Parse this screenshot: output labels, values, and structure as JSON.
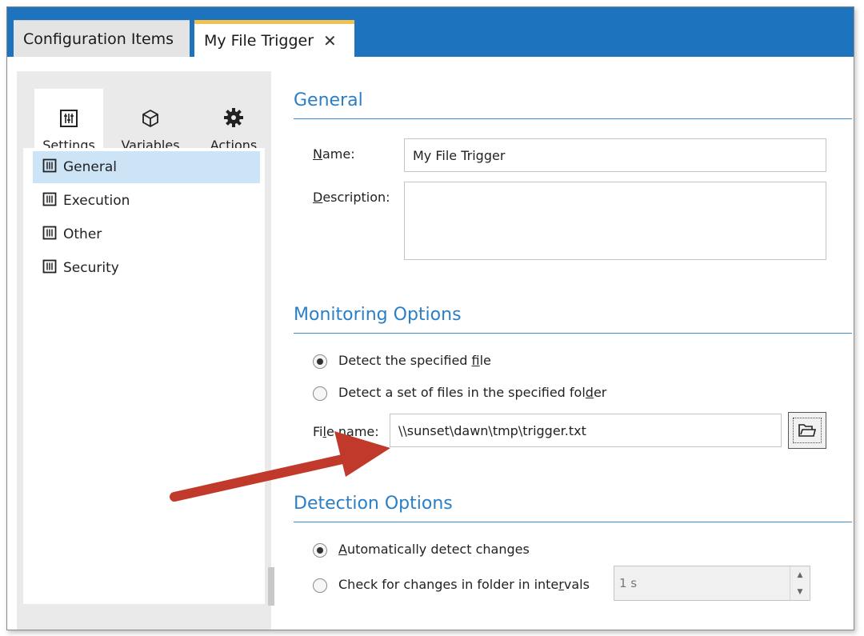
{
  "tabs": [
    {
      "label": "Configuration Items"
    },
    {
      "label": "My File Trigger",
      "close_glyph": "✕"
    }
  ],
  "sidebar": {
    "vertical_tabs": [
      {
        "label": "Settings",
        "icon": "sliders-icon"
      },
      {
        "label": "Variables",
        "icon": "cube-icon"
      },
      {
        "label": "Actions",
        "icon": "gear-icon"
      }
    ],
    "items": [
      {
        "label": "General",
        "icon": "sliders-icon"
      },
      {
        "label": "Execution",
        "icon": "sliders-icon"
      },
      {
        "label": "Other",
        "icon": "sliders-icon"
      },
      {
        "label": "Security",
        "icon": "sliders-icon"
      }
    ]
  },
  "general": {
    "title": "General",
    "name_label_first": "N",
    "name_label_rest": "ame:",
    "name_value": "My File Trigger",
    "description_label_first": "D",
    "description_label_rest": "escription:",
    "description_value": ""
  },
  "monitoring": {
    "title": "Monitoring Options",
    "option1_pre": "Detect the specified ",
    "option1_u": "f",
    "option1_post": "ile",
    "option2_pre": "Detect a set of files in the specified fol",
    "option2_u": "d",
    "option2_post": "er",
    "filename_label_pre": "Fi",
    "filename_label_u": "l",
    "filename_label_post": "e name:",
    "filename_value": "\\\\sunset\\dawn\\tmp\\trigger.txt"
  },
  "detection": {
    "title": "Detection Options",
    "option1_u": "A",
    "option1_post": "utomatically detect changes",
    "option2_pre": "Check for changes in folder in inte",
    "option2_u": "r",
    "option2_post": "vals",
    "interval_value": "1 s"
  },
  "colors": {
    "tab_bar": "#1e73be",
    "active_tab_accent": "#f2c14e",
    "section_title": "#2a7fc6",
    "selected_item": "#cde4f7",
    "arrow": "#c0392b"
  }
}
